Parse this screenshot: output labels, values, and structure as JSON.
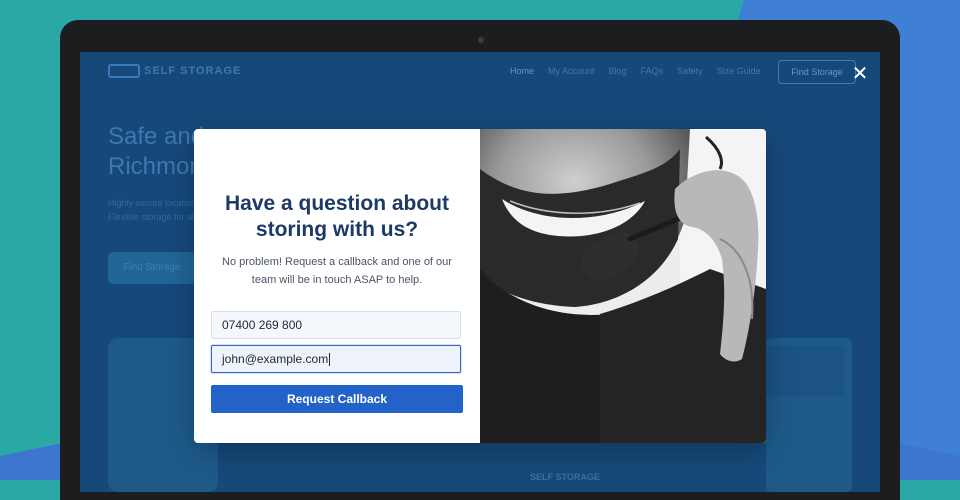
{
  "site": {
    "logo_text": "SELF STORAGE",
    "nav_links": [
      "Home",
      "My Account",
      "Blog",
      "FAQs",
      "Safety",
      "Size Guide"
    ],
    "nav_cta": "Find Storage",
    "hero_title": "Safe and Richmond",
    "hero_subtitle": "Highly secure locations. Flexible storage for all needs.",
    "hero_button": "Find Storage",
    "footer_logo": "SELF STORAGE"
  },
  "modal": {
    "title": "Have a question about storing with us?",
    "description": "No problem! Request a callback and one of our team will be in touch ASAP to help.",
    "phone_value": "07400 269 800",
    "email_value": "john@example.com",
    "submit_label": "Request Callback",
    "close_glyph": "✕",
    "image_alt": "Smiling support agent with headset"
  },
  "colors": {
    "accent": "#2362c9",
    "title": "#1d3a66",
    "screen_overlay": "#16497a",
    "background_teal": "#2aa8a6",
    "background_blue": "#3f7fd6"
  }
}
